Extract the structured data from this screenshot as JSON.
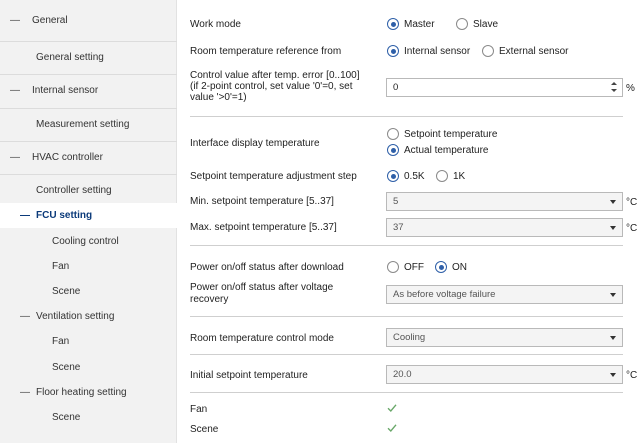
{
  "sidebar": {
    "items": [
      {
        "dash": "—",
        "label": "General"
      },
      {
        "label": "General setting"
      },
      {
        "dash": "—",
        "label": "Internal sensor"
      },
      {
        "label": "Measurement setting"
      },
      {
        "dash": "—",
        "label": "HVAC controller"
      },
      {
        "label": "Controller setting"
      },
      {
        "dash": "—",
        "label": "FCU setting",
        "selected": true
      },
      {
        "label": "Cooling control"
      },
      {
        "label": "Fan"
      },
      {
        "label": "Scene"
      },
      {
        "dash": "—",
        "label": "Ventilation setting"
      },
      {
        "label": "Fan"
      },
      {
        "label": "Scene"
      },
      {
        "dash": "—",
        "label": "Floor heating setting"
      },
      {
        "label": "Scene"
      }
    ]
  },
  "form": {
    "work_mode": {
      "label": "Work mode",
      "options": [
        "Master",
        "Slave"
      ],
      "selected": "Master"
    },
    "room_temp_ref": {
      "label": "Room temperature reference from",
      "options": [
        "Internal sensor",
        "External sensor"
      ],
      "selected": "Internal sensor"
    },
    "control_value": {
      "label_lines": [
        "Control value after temp. error [0..100]",
        "(if 2-point control, set value '0'=0, set",
        "value '>0'=1)"
      ],
      "value": "0",
      "unit": "%"
    },
    "interface_display": {
      "label": "Interface display temperature",
      "options": [
        "Setpoint temperature",
        "Actual temperature"
      ],
      "selected": "Actual temperature"
    },
    "setpoint_step": {
      "label": "Setpoint temperature adjustment step",
      "options": [
        "0.5K",
        "1K"
      ],
      "selected": "0.5K"
    },
    "min_setpoint": {
      "label": "Min. setpoint temperature [5..37]",
      "value": "5",
      "unit": "°C"
    },
    "max_setpoint": {
      "label": "Max. setpoint temperature [5..37]",
      "value": "37",
      "unit": "°C"
    },
    "power_after_download": {
      "label": "Power on/off status after download",
      "options": [
        "OFF",
        "ON"
      ],
      "selected": "ON"
    },
    "power_after_voltage": {
      "label_lines": [
        "Power on/off status after voltage",
        "recovery"
      ],
      "value": "As before voltage failure"
    },
    "control_mode": {
      "label": "Room temperature control mode",
      "value": "Cooling"
    },
    "initial_setpoint": {
      "label": "Initial setpoint temperature",
      "value": "20.0",
      "unit": "°C"
    },
    "fan": {
      "label": "Fan",
      "checked": true
    },
    "scene": {
      "label": "Scene",
      "checked": true
    }
  },
  "colors": {
    "accent": "#2e5fa8",
    "selected_nav": "#0b3a7a",
    "sidebar_bg": "#f2f2f2",
    "check": "#6aa86a"
  }
}
